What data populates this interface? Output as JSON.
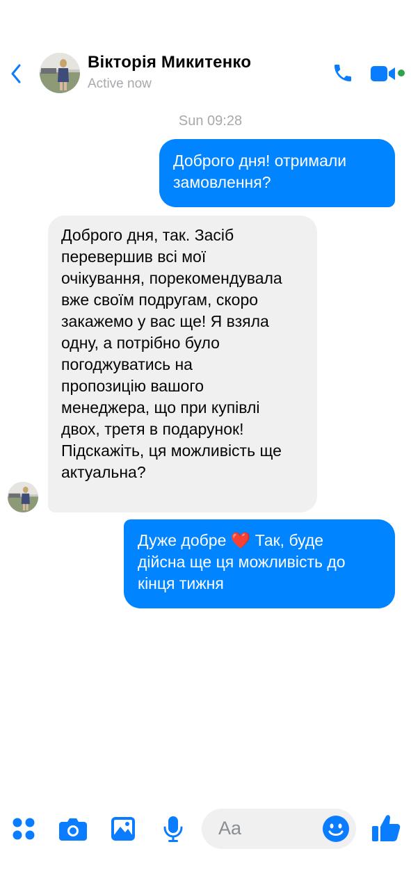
{
  "header": {
    "contact_name": "Вікторія Микитенко",
    "status": "Active now"
  },
  "conversation": {
    "timestamp": "Sun 09:28",
    "messages": [
      {
        "direction": "outgoing",
        "text": "Доброго дня! отримали\nзамовлення?"
      },
      {
        "direction": "incoming",
        "text": "Доброго дня, так. Засіб\nперевершив всі мої\nочікування, порекомендувала\nвже своїм подругам, скоро\nзакажемо у вас ще! Я взяла\nодну, а потрібно було\nпогоджуватись на\nпропозицію вашого\nменеджера, що при купівлі\nдвох, третя в подарунок!\nПідскажіть, ця можливість ще\nактуальна?"
      },
      {
        "direction": "outgoing",
        "text_before_emoji": "Дуже добре ",
        "emoji": "❤️",
        "text_after_emoji": " Так, буде\nдійсна ще ця можливість до\nкінця тижня"
      }
    ]
  },
  "composer": {
    "placeholder": "Aa"
  },
  "icons": {
    "back": "chevron-left-icon",
    "call": "phone-icon",
    "video": "video-camera-icon",
    "menu": "four-dots-icon",
    "camera": "camera-icon",
    "photo": "image-icon",
    "mic": "microphone-icon",
    "emoji": "smiley-icon",
    "like": "thumbs-up-icon"
  },
  "colors": {
    "accent": "#0084ff",
    "incoming_bubble": "#f0f0f0",
    "online": "#31a24c",
    "muted_text": "#a8a8ad"
  }
}
